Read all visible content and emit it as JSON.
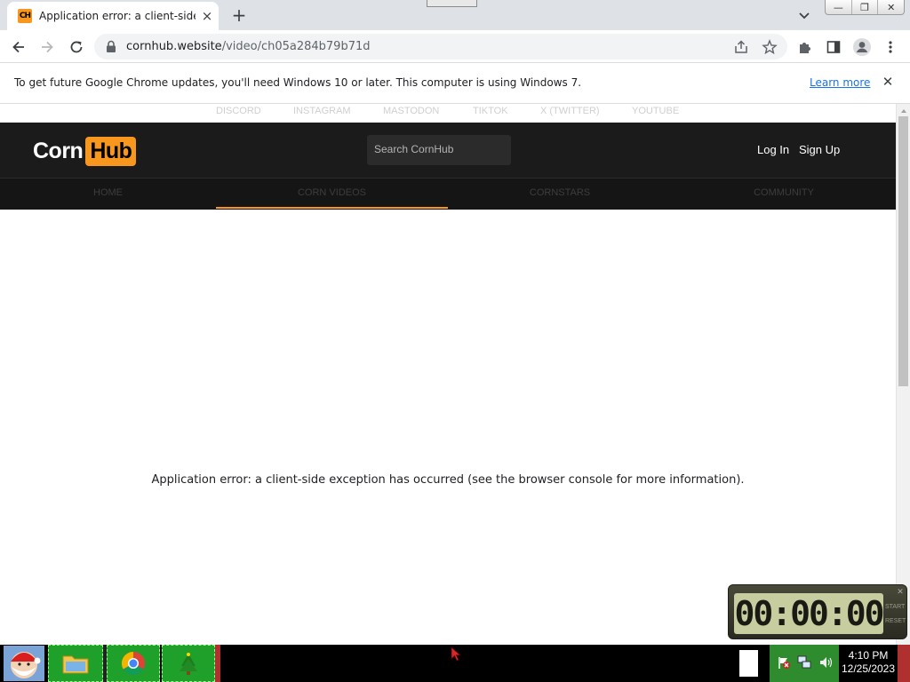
{
  "browser": {
    "tab": {
      "favicon_text": "CH",
      "title": "Application error: a client-side exception has occurred"
    },
    "window_buttons": {
      "minimize": "—",
      "maximize": "❐",
      "close": "✕"
    },
    "url": {
      "host": "cornhub.website",
      "path": "/video/ch05a284b79b71d"
    },
    "infobar": {
      "text": "To get future Google Chrome updates, you'll need Windows 10 or later. This computer is using Windows 7.",
      "link": "Learn more"
    }
  },
  "site": {
    "social_links": [
      "DISCORD",
      "INSTAGRAM",
      "MASTODON",
      "TIKTOK",
      "X (TWITTER)",
      "YOUTUBE"
    ],
    "logo": {
      "part1": "Corn",
      "part2": "Hub"
    },
    "search_placeholder": "Search CornHub",
    "header_links": {
      "login": "Log In",
      "signup": "Sign Up"
    },
    "nav": [
      "HOME",
      "CORN VIDEOS",
      "CORNSTARS",
      "COMMUNITY"
    ],
    "active_nav": "CORN VIDEOS",
    "accent_color": "#f7971d",
    "error": "Application error: a client-side exception has occurred (see the browser console for more information)."
  },
  "timer": {
    "display": "00:00:00",
    "side_top": "START",
    "side_bottom": "RESET"
  },
  "taskbar": {
    "time": "4:10 PM",
    "date": "12/25/2023"
  }
}
